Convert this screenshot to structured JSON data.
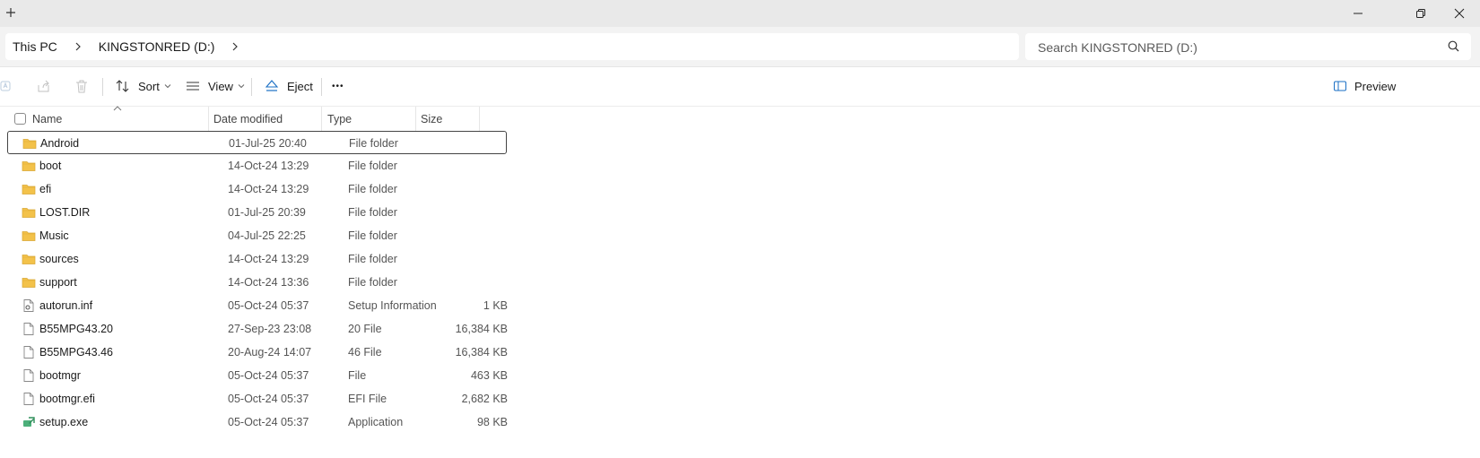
{
  "window": {
    "new_tab_label": "+"
  },
  "address": {
    "crumbs": [
      "This PC",
      "KINGSTONRED (D:)"
    ],
    "search_placeholder": "Search KINGSTONRED (D:)"
  },
  "toolbar": {
    "sort_label": "Sort",
    "view_label": "View",
    "eject_label": "Eject",
    "more_label": "•••",
    "preview_label": "Preview"
  },
  "columns": {
    "name": "Name",
    "date": "Date modified",
    "type": "Type",
    "size": "Size"
  },
  "files": [
    {
      "name": "Android",
      "date": "01-Jul-25 20:40",
      "type": "File folder",
      "size": "",
      "icon": "folder-icon",
      "selected": true
    },
    {
      "name": "boot",
      "date": "14-Oct-24 13:29",
      "type": "File folder",
      "size": "",
      "icon": "folder-icon"
    },
    {
      "name": "efi",
      "date": "14-Oct-24 13:29",
      "type": "File folder",
      "size": "",
      "icon": "folder-icon"
    },
    {
      "name": "LOST.DIR",
      "date": "01-Jul-25 20:39",
      "type": "File folder",
      "size": "",
      "icon": "folder-icon"
    },
    {
      "name": "Music",
      "date": "04-Jul-25 22:25",
      "type": "File folder",
      "size": "",
      "icon": "folder-icon"
    },
    {
      "name": "sources",
      "date": "14-Oct-24 13:29",
      "type": "File folder",
      "size": "",
      "icon": "folder-icon"
    },
    {
      "name": "support",
      "date": "14-Oct-24 13:36",
      "type": "File folder",
      "size": "",
      "icon": "folder-icon"
    },
    {
      "name": "autorun.inf",
      "date": "05-Oct-24 05:37",
      "type": "Setup Information",
      "size": "1 KB",
      "icon": "setup-file-icon"
    },
    {
      "name": "B55MPG43.20",
      "date": "27-Sep-23 23:08",
      "type": "20 File",
      "size": "16,384 KB",
      "icon": "file-icon"
    },
    {
      "name": "B55MPG43.46",
      "date": "20-Aug-24 14:07",
      "type": "46 File",
      "size": "16,384 KB",
      "icon": "file-icon"
    },
    {
      "name": "bootmgr",
      "date": "05-Oct-24 05:37",
      "type": "File",
      "size": "463 KB",
      "icon": "file-icon"
    },
    {
      "name": "bootmgr.efi",
      "date": "05-Oct-24 05:37",
      "type": "EFI File",
      "size": "2,682 KB",
      "icon": "file-icon"
    },
    {
      "name": "setup.exe",
      "date": "05-Oct-24 05:37",
      "type": "Application",
      "size": "98 KB",
      "icon": "setup-exe-icon"
    }
  ],
  "colors": {
    "titlebar": "#e9e9e9",
    "addressbar": "#f3f3f3",
    "folder": "#f3c24a",
    "eject_accent": "#1a6fc4",
    "preview_accent": "#1a6fc4"
  }
}
